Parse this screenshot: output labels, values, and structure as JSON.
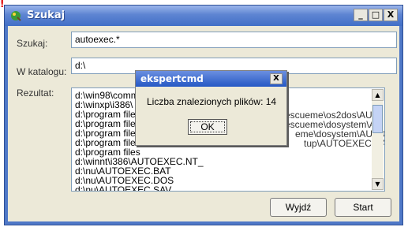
{
  "corner_marker": "!",
  "window": {
    "title": "Szukaj",
    "controls": {
      "minimize": "_",
      "maximize": "□",
      "close": "X"
    }
  },
  "form": {
    "search_label": "Szukaj:",
    "search_value": "autoexec.*",
    "folder_label": "W katalogu:",
    "folder_value": "d:\\",
    "results_label": "Rezultat:"
  },
  "results": [
    "d:\\win98\\comm",
    "d:\\winxp\\i386\\",
    "d:\\program files",
    "d:\\program files",
    "d:\\program files",
    "d:\\program files",
    "d:\\program files",
    "d:\\winnt\\i386\\AUTOEXEC.NT_",
    "d:\\nu\\AUTOEXEC.BAT",
    "d:\\nu\\AUTOEXEC.DOS",
    "d:\\nu\\AUTOEXEC.SAV"
  ],
  "results_visible_tails": [
    "escueme\\os2dos\\AUT",
    "escueme\\dosystem\\AL",
    "eme\\dosystem\\AUTO",
    "tup\\AUTOEXEC.BAT"
  ],
  "buttons": {
    "exit": "Wyjdź",
    "start": "Start"
  },
  "dialog": {
    "title": "ekspertcmd",
    "message": "Liczba znalezionych plików: 14",
    "ok": "OK",
    "close": "X"
  }
}
